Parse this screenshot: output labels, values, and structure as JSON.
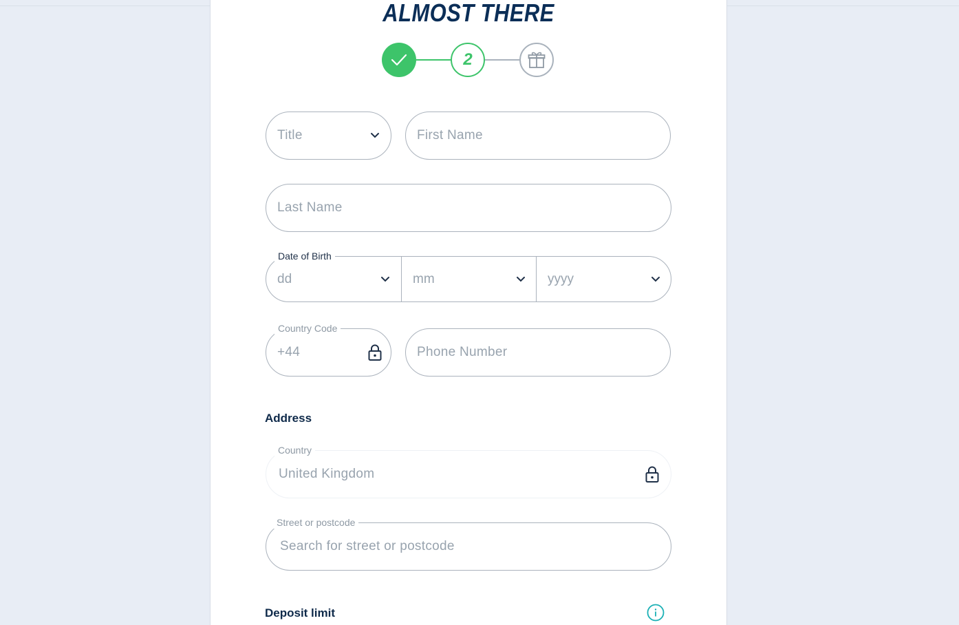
{
  "page": {
    "heading": "ALMOST THERE"
  },
  "stepper": {
    "current_step_label": "2"
  },
  "form": {
    "title": {
      "placeholder": "Title"
    },
    "first_name": {
      "placeholder": "First Name"
    },
    "last_name": {
      "placeholder": "Last Name"
    },
    "dob": {
      "legend": "Date of Birth",
      "day_placeholder": "dd",
      "month_placeholder": "mm",
      "year_placeholder": "yyyy"
    },
    "country_code": {
      "legend": "Country Code",
      "value": "+44"
    },
    "phone": {
      "placeholder": "Phone Number"
    },
    "address_heading": "Address",
    "country": {
      "legend": "Country",
      "value": "United Kingdom"
    },
    "street": {
      "legend": "Street or postcode",
      "placeholder": "Search for street or postcode"
    },
    "deposit_limit_heading": "Deposit limit"
  },
  "colors": {
    "accent_green": "#3dc46a",
    "heading_navy": "#0b2e57",
    "info_teal": "#1ab0b5",
    "border_grey": "#aab2bc"
  },
  "icons": [
    "check-icon",
    "gift-icon",
    "chevron-down-icon",
    "lock-icon",
    "info-icon"
  ]
}
